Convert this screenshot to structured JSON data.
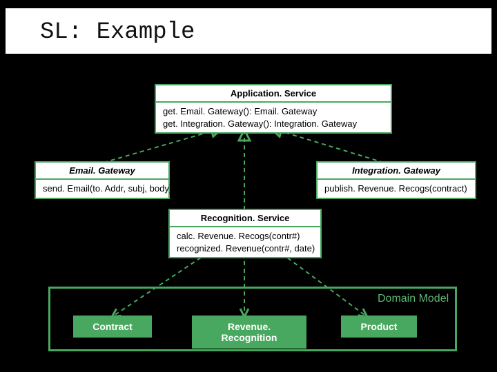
{
  "title": "SL: Example",
  "appService": {
    "name": "Application. Service",
    "m1": "get. Email. Gateway(): Email. Gateway",
    "m2": "get. Integration. Gateway(): Integration. Gateway"
  },
  "emailGateway": {
    "name": "Email. Gateway",
    "m1": "send. Email(to. Addr, subj, body)"
  },
  "integrationGateway": {
    "name": "Integration. Gateway",
    "m1": "publish. Revenue. Recogs(contract)"
  },
  "recognitionService": {
    "name": "Recognition. Service",
    "m1": "calc. Revenue. Recogs(contr#)",
    "m2": "recognized. Revenue(contr#, date)"
  },
  "domainLabel": "Domain Model",
  "contract": "Contract",
  "revenueRecognition": "Revenue. Recognition",
  "product": "Product",
  "colors": {
    "accent": "#48a85f"
  }
}
